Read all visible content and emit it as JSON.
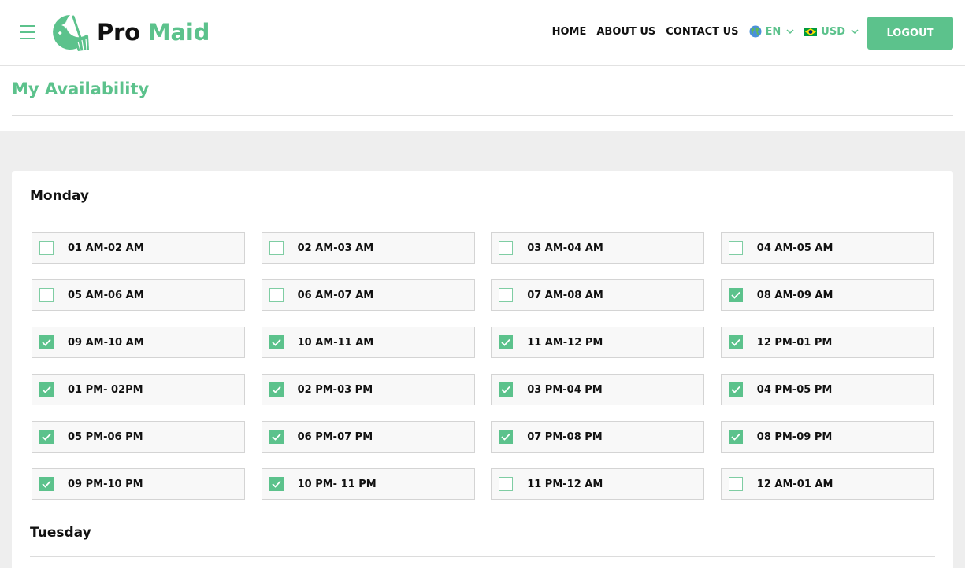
{
  "header": {
    "logo_pro": "Pro",
    "logo_maid": "Maid",
    "nav": [
      "HOME",
      "ABOUT US",
      "CONTACT US"
    ],
    "language": "EN",
    "currency": "USD",
    "logout_label": "LOGOUT"
  },
  "page": {
    "title": "My Availability"
  },
  "days": [
    {
      "name": "Monday",
      "slots": [
        {
          "label": "01 AM-02 AM",
          "checked": false
        },
        {
          "label": "02 AM-03 AM",
          "checked": false
        },
        {
          "label": "03 AM-04 AM",
          "checked": false
        },
        {
          "label": "04 AM-05 AM",
          "checked": false
        },
        {
          "label": "05 AM-06 AM",
          "checked": false
        },
        {
          "label": "06 AM-07 AM",
          "checked": false
        },
        {
          "label": "07 AM-08 AM",
          "checked": false
        },
        {
          "label": "08 AM-09 AM",
          "checked": true
        },
        {
          "label": "09 AM-10 AM",
          "checked": true
        },
        {
          "label": "10 AM-11 AM",
          "checked": true
        },
        {
          "label": "11 AM-12 PM",
          "checked": true
        },
        {
          "label": "12 PM-01 PM",
          "checked": true
        },
        {
          "label": "01 PM- 02PM",
          "checked": true
        },
        {
          "label": "02 PM-03 PM",
          "checked": true
        },
        {
          "label": "03 PM-04 PM",
          "checked": true
        },
        {
          "label": "04 PM-05 PM",
          "checked": true
        },
        {
          "label": "05 PM-06 PM",
          "checked": true
        },
        {
          "label": "06 PM-07 PM",
          "checked": true
        },
        {
          "label": "07 PM-08 PM",
          "checked": true
        },
        {
          "label": "08 PM-09 PM",
          "checked": true
        },
        {
          "label": "09 PM-10 PM",
          "checked": true
        },
        {
          "label": "10 PM- 11 PM",
          "checked": true
        },
        {
          "label": "11 PM-12 AM",
          "checked": false
        },
        {
          "label": "12 AM-01 AM",
          "checked": false
        }
      ]
    },
    {
      "name": "Tuesday",
      "slots": []
    }
  ],
  "colors": {
    "accent": "#5cc28c",
    "page_bg": "#eeeeee",
    "slot_bg": "#f8f8f8"
  },
  "icons": [
    "menu-icon",
    "broom-logo-icon",
    "globe-icon",
    "flag-icon",
    "chevron-down-icon",
    "checkmark-icon"
  ]
}
